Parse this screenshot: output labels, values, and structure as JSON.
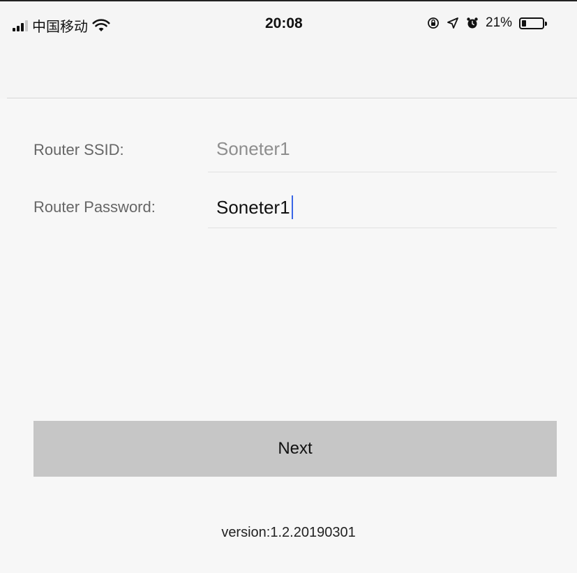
{
  "status_bar": {
    "carrier": "中国移动",
    "time": "20:08",
    "battery_percent": "21%",
    "battery_level": 0.21,
    "icons": [
      "signal-icon",
      "wifi-icon",
      "orientation-lock-icon",
      "location-icon",
      "alarm-icon",
      "battery-icon"
    ]
  },
  "form": {
    "ssid_label": "Router SSID:",
    "ssid_value": "Soneter1",
    "password_label": "Router Password:",
    "password_value": "Soneter1"
  },
  "next_button_label": "Next",
  "version_text": "version:1.2.20190301",
  "colors": {
    "cursor": "#3a66e6",
    "button_bg": "#c6c6c6",
    "background": "#f5f5f5"
  }
}
